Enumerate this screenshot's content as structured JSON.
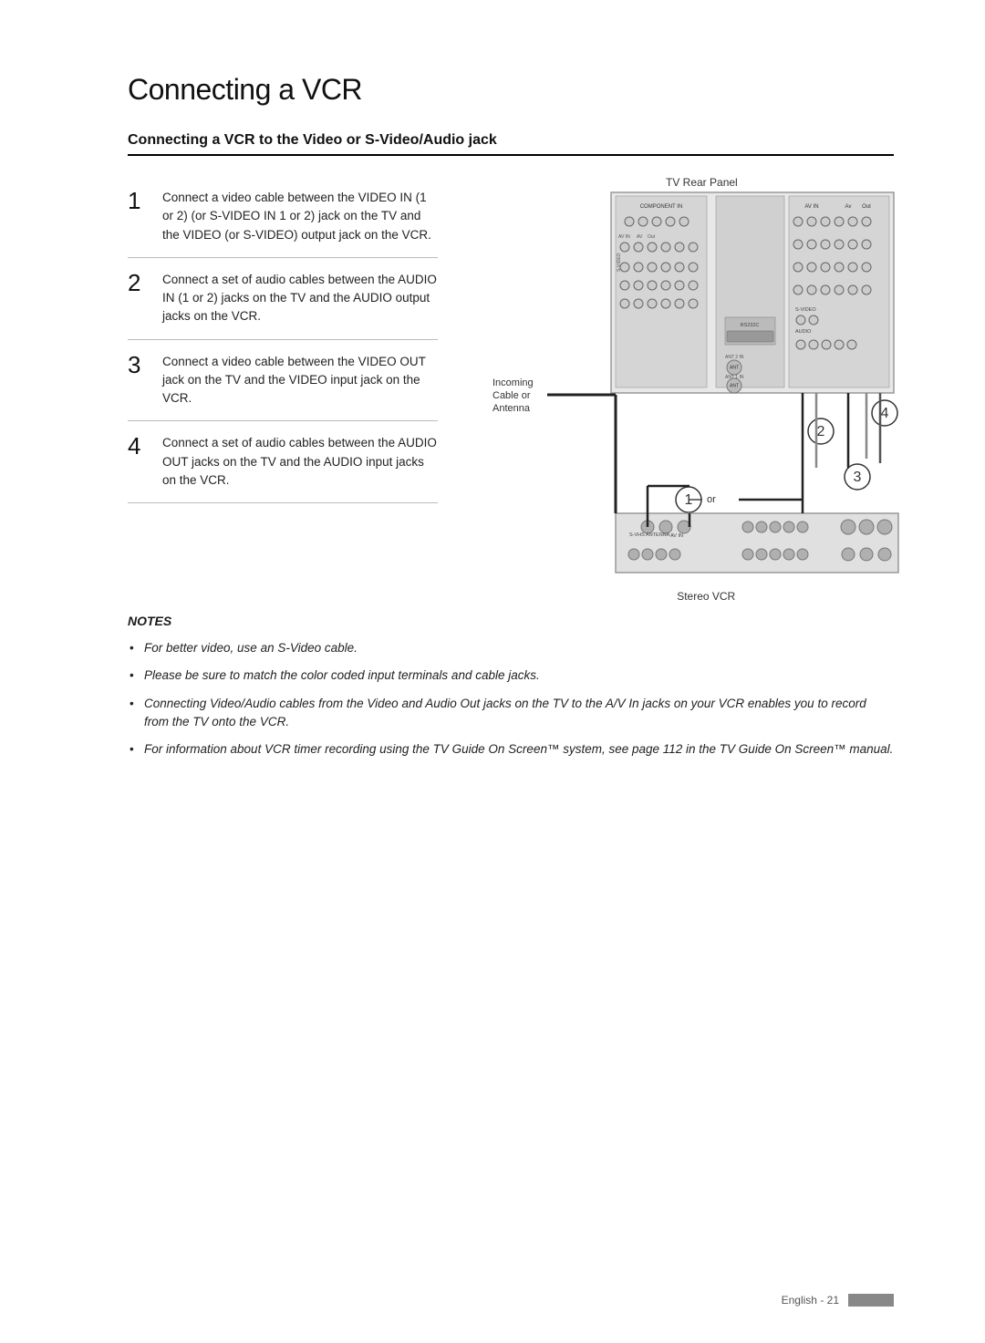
{
  "page": {
    "title": "Connecting a VCR",
    "section_title": "Connecting a VCR to the Video or S-Video/Audio jack",
    "footer": {
      "text": "English - 21"
    }
  },
  "steps": [
    {
      "number": "1",
      "text": "Connect a video cable between the VIDEO IN (1 or 2) (or S-VIDEO IN 1 or 2) jack on the TV and the VIDEO (or S-VIDEO) output jack on the VCR."
    },
    {
      "number": "2",
      "text": "Connect a set of audio cables between the AUDIO IN (1 or 2) jacks on the TV and the AUDIO output jacks on the VCR."
    },
    {
      "number": "3",
      "text": "Connect a video cable between the VIDEO OUT jack on the TV and the VIDEO input jack on the VCR."
    },
    {
      "number": "4",
      "text": "Connect a set of audio cables between the AUDIO OUT jacks on the TV and the AUDIO input jacks on the VCR."
    }
  ],
  "diagram": {
    "tv_rear_label": "TV Rear Panel",
    "incoming_label": "Incoming\nCable or\nAntenna",
    "stereo_vcr_label": "Stereo VCR",
    "number_labels": [
      "1",
      "2",
      "3",
      "4"
    ]
  },
  "notes": {
    "title": "NOTES",
    "items": [
      "For better video, use an S-Video cable.",
      "Please be sure to match the color coded input terminals and cable jacks.",
      "Connecting Video/Audio cables from the Video and Audio Out jacks on the TV to the A/V In jacks on your VCR enables you to record from the TV onto the VCR.",
      "For information about VCR timer recording using the TV Guide On Screen™ system, see page 112 in the TV Guide On Screen™ manual."
    ]
  }
}
